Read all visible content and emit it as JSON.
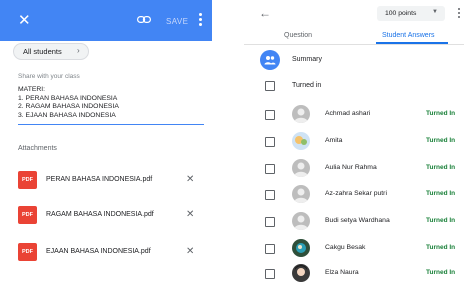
{
  "colors": {
    "accent": "#4285f4",
    "pdf": "#ea4335",
    "turned_in": "#188038",
    "tab_active": "#1a73e8"
  },
  "left": {
    "header": {
      "close_icon": "close-icon",
      "save_label": "SAVE",
      "link_icon": "link-icon",
      "menu_icon": "more-vert-icon"
    },
    "audience_chip": "All students",
    "share_hint": "Share with your class",
    "materi_text": "MATERI:\n1. PERAN BAHASA INDONESIA\n2. RAGAM BAHASA INDONESIA\n3. EJAAN BAHASA INDONESIA",
    "attachments_label": "Attachments",
    "attachments": [
      {
        "icon_label": "PDF",
        "name": "PERAN BAHASA INDONESIA.pdf"
      },
      {
        "icon_label": "PDF",
        "name": "RAGAM BAHASA INDONESIA.pdf"
      },
      {
        "icon_label": "PDF",
        "name": "EJAAN BAHASA INDONESIA.pdf"
      }
    ]
  },
  "right": {
    "points_label": "100 points",
    "tabs": [
      "Question",
      "Student Answers"
    ],
    "summary_label": "Summary",
    "turned_in_header": "Turned in",
    "students": [
      {
        "name": "Achmad ashari",
        "status": "Turned In"
      },
      {
        "name": "Amita",
        "status": "Turned In"
      },
      {
        "name": "Aulia Nur Rahma",
        "status": "Turned In"
      },
      {
        "name": "Az-zahra Sekar putri",
        "status": "Turned In"
      },
      {
        "name": "Budi setya Wardhana",
        "status": "Turned In"
      },
      {
        "name": "Cakgu Besak",
        "status": "Turned In"
      },
      {
        "name": "Elza Naura",
        "status": "Turned In"
      }
    ]
  }
}
